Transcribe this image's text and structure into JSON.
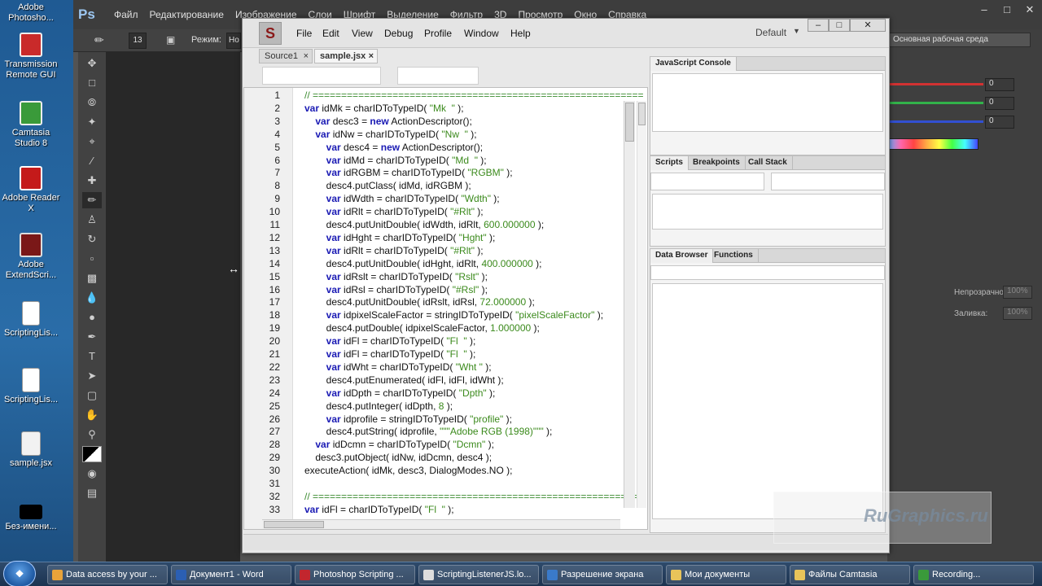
{
  "desktop": {
    "icons": [
      {
        "label": "Adobe Photosho...",
        "color": "#0a3a6e"
      },
      {
        "label": "Transmission Remote GUI",
        "color": "#c92a2a"
      },
      {
        "label": "Camtasia Studio 8",
        "color": "#3a9a3a"
      },
      {
        "label": "Adobe Reader X",
        "color": "#c41a1a"
      },
      {
        "label": "Adobe ExtendScri...",
        "color": "#7a1818"
      },
      {
        "label": "ScriptingLis...",
        "color": "#ffffff"
      },
      {
        "label": "ScriptingLis...",
        "color": "#ffffff"
      },
      {
        "label": "sample.jsx",
        "color": "#f2f2f2"
      },
      {
        "label": "Без-имени...",
        "color": "#000000"
      }
    ]
  },
  "photoshop": {
    "logo": "Ps",
    "menu": [
      "Файл",
      "Редактирование",
      "Изображение",
      "Слои",
      "Шрифт",
      "Выделение",
      "Фильтр",
      "3D",
      "Просмотр",
      "Окно",
      "Справка"
    ],
    "options": {
      "brush_size": "13",
      "mode_label": "Режим:",
      "mode_value": "Но"
    },
    "right": {
      "workspace": "Основная рабочая среда",
      "rgb_values": [
        "0",
        "0",
        "0"
      ],
      "opacity_label": "Непрозрачность:",
      "opacity_value": "100%",
      "fill_label": "Заливка:",
      "fill_value": "100%"
    }
  },
  "extendscript": {
    "menu": [
      "File",
      "Edit",
      "View",
      "Debug",
      "Profile",
      "Window",
      "Help"
    ],
    "workspace": "Default",
    "tabs": [
      "Source1",
      "sample.jsx"
    ],
    "active_tab": "sample.jsx",
    "lines": [
      "// ==========================================================",
      "var idMk = charIDToTypeID( \"Mk  \" );",
      "    var desc3 = new ActionDescriptor();",
      "    var idNw = charIDToTypeID( \"Nw  \" );",
      "        var desc4 = new ActionDescriptor();",
      "        var idMd = charIDToTypeID( \"Md  \" );",
      "        var idRGBM = charIDToTypeID( \"RGBM\" );",
      "        desc4.putClass( idMd, idRGBM );",
      "        var idWdth = charIDToTypeID( \"Wdth\" );",
      "        var idRlt = charIDToTypeID( \"#Rlt\" );",
      "        desc4.putUnitDouble( idWdth, idRlt, 600.000000 );",
      "        var idHght = charIDToTypeID( \"Hght\" );",
      "        var idRlt = charIDToTypeID( \"#Rlt\" );",
      "        desc4.putUnitDouble( idHght, idRlt, 400.000000 );",
      "        var idRslt = charIDToTypeID( \"Rslt\" );",
      "        var idRsl = charIDToTypeID( \"#Rsl\" );",
      "        desc4.putUnitDouble( idRslt, idRsl, 72.000000 );",
      "        var idpixelScaleFactor = stringIDToTypeID( \"pixelScaleFactor\" );",
      "        desc4.putDouble( idpixelScaleFactor, 1.000000 );",
      "        var idFl = charIDToTypeID( \"Fl  \" );",
      "        var idFl = charIDToTypeID( \"Fl  \" );",
      "        var idWht = charIDToTypeID( \"Wht \" );",
      "        desc4.putEnumerated( idFl, idFl, idWht );",
      "        var idDpth = charIDToTypeID( \"Dpth\" );",
      "        desc4.putInteger( idDpth, 8 );",
      "        var idprofile = stringIDToTypeID( \"profile\" );",
      "        desc4.putString( idprofile, \"\"\"Adobe RGB (1998)\"\"\" );",
      "    var idDcmn = charIDToTypeID( \"Dcmn\" );",
      "    desc3.putObject( idNw, idDcmn, desc4 );",
      "executeAction( idMk, desc3, DialogModes.NO );",
      "",
      "// ==========================================================",
      "var idFl = charIDToTypeID( \"Fl  \" );"
    ],
    "panels": {
      "console": "JavaScript Console",
      "scripts_tabs": [
        "Scripts",
        "Breakpoints",
        "Call Stack"
      ],
      "data_tabs": [
        "Data Browser",
        "Functions"
      ]
    }
  },
  "taskbar": [
    {
      "label": "Data access by your ...",
      "color": "#e8a33a"
    },
    {
      "label": "Документ1 - Word",
      "color": "#2b5fb3"
    },
    {
      "label": "Photoshop Scripting ...",
      "color": "#c2262e"
    },
    {
      "label": "ScriptingListenerJS.lo...",
      "color": "#dddddd"
    },
    {
      "label": "Разрешение экрана",
      "color": "#3a7ac9"
    },
    {
      "label": "Мои документы",
      "color": "#e8c45a"
    },
    {
      "label": "Файлы Camtasia",
      "color": "#e8c45a"
    },
    {
      "label": "Recording...",
      "color": "#3a9a3a"
    }
  ],
  "watermark": "RuGraphics.ru"
}
